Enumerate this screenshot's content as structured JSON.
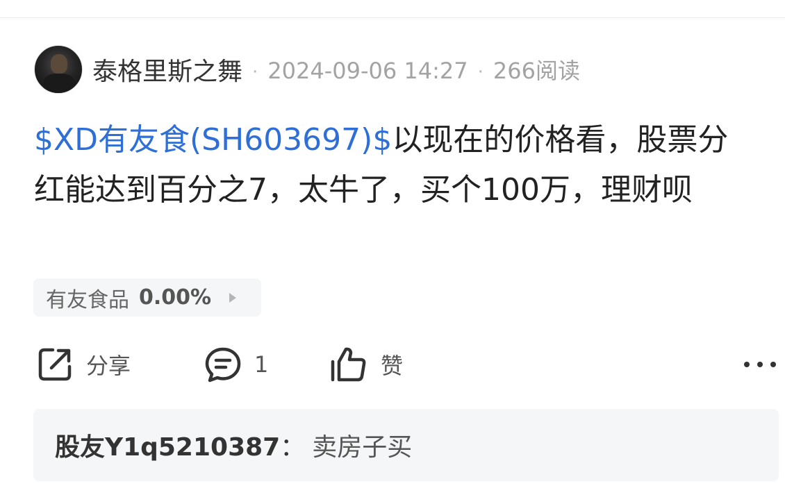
{
  "post": {
    "author": "泰格里斯之舞",
    "date": "2024-09-06 14:27",
    "read_count": "266阅读",
    "meta_separator": "·",
    "stock_link": "$XD有友食(SH603697)$",
    "body": "以现在的价格看，股票分红能达到百分之7，太牛了，买个100万，理财呗"
  },
  "stock_chip": {
    "name": "有友食品",
    "change": "0.00%"
  },
  "actions": {
    "share_label": "分享",
    "comment_count": "1",
    "like_label": "赞"
  },
  "comment": {
    "commenter": "股友Y1q5210387",
    "separator": "：",
    "text": "卖房子买"
  },
  "icons": {
    "share": "share-icon",
    "comment": "comment-icon",
    "like": "thumbs-up-icon",
    "more": "more-horizontal-icon"
  },
  "colors": {
    "link": "#2e6fd7",
    "meta_gray": "#a3a3a3",
    "chip_bg": "#f5f6f7"
  }
}
